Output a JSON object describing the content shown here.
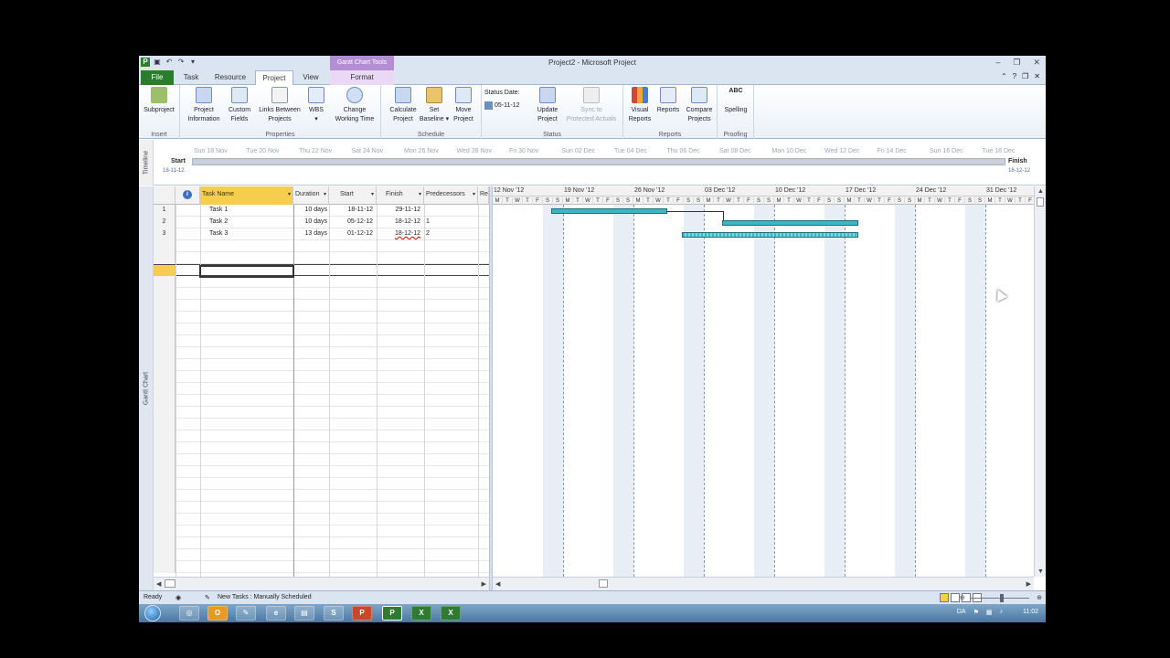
{
  "window": {
    "title": "Project2 - Microsoft Project",
    "contextual_tab": "Gantt Chart Tools"
  },
  "tabs": [
    {
      "label": "File"
    },
    {
      "label": "Task"
    },
    {
      "label": "Resource"
    },
    {
      "label": "Project",
      "active": true
    },
    {
      "label": "View"
    },
    {
      "label": "Format"
    }
  ],
  "ribbon": {
    "insert": {
      "label": "Insert",
      "subproject": "Subproject"
    },
    "properties": {
      "label": "Properties",
      "project_information": "Project\nInformation",
      "custom_fields": "Custom\nFields",
      "links_between_projects": "Links Between\nProjects",
      "wbs": "WBS\n▾",
      "change_working_time": "Change\nWorking Time"
    },
    "schedule": {
      "label": "Schedule",
      "calculate_project": "Calculate\nProject",
      "set_baseline": "Set\nBaseline ▾",
      "move_project": "Move\nProject"
    },
    "status": {
      "label": "Status",
      "status_date_label": "Status Date:",
      "status_date_value": "05-11-12",
      "update_project": "Update\nProject",
      "sync_protected": "Sync to\nProtected Actuals"
    },
    "reports": {
      "label": "Reports",
      "visual_reports": "Visual\nReports",
      "reports": "Reports",
      "compare_projects": "Compare\nProjects"
    },
    "proofing": {
      "label": "Proofing",
      "spelling": "Spelling",
      "spelling_icon_text": "ABC"
    }
  },
  "timeline": {
    "label": "Timeline",
    "dates": [
      "Sun 18 Nov",
      "Tue 20 Nov",
      "Thu 22 Nov",
      "Sat 24 Nov",
      "Mon 26 Nov",
      "Wed 28 Nov",
      "Fri 30 Nov",
      "Sun 02 Dec",
      "Tue 04 Dec",
      "Thu 06 Dec",
      "Sat 08 Dec",
      "Mon 10 Dec",
      "Wed 12 Dec",
      "Fri 14 Dec",
      "Sun 16 Dec",
      "Tue 18 Dec"
    ],
    "start_label": "Start",
    "start_date": "18-11-12",
    "finish_label": "Finish",
    "finish_date": "18-12-12"
  },
  "grid": {
    "side_label": "Gantt Chart",
    "info_icon_text": "i",
    "columns": [
      "Task Name",
      "Duration",
      "Start",
      "Finish",
      "Predecessors",
      "Re"
    ],
    "rows": [
      {
        "id": "1",
        "name": "Task 1",
        "duration": "10 days",
        "start": "18-11-12",
        "finish": "29-11-12",
        "pred": ""
      },
      {
        "id": "2",
        "name": "Task 2",
        "duration": "10 days",
        "start": "05-12-12",
        "finish": "18-12-12",
        "pred": "1"
      },
      {
        "id": "3",
        "name": "Task 3",
        "duration": "13 days",
        "start": "01-12-12",
        "finish": "18-12-12",
        "pred": "2"
      }
    ]
  },
  "chart": {
    "weeks": [
      "12 Nov '12",
      "19 Nov '12",
      "26 Nov '12",
      "03 Dec '12",
      "10 Dec '12",
      "17 Dec '12",
      "24 Dec '12",
      "31 Dec '12"
    ],
    "day_letters": [
      "M",
      "T",
      "W",
      "T",
      "F",
      "S",
      "S"
    ]
  },
  "statusbar": {
    "ready": "Ready",
    "new_tasks": "New Tasks : Manually Scheduled"
  },
  "taskbar": {
    "lang": "DA",
    "time": "11:02"
  }
}
